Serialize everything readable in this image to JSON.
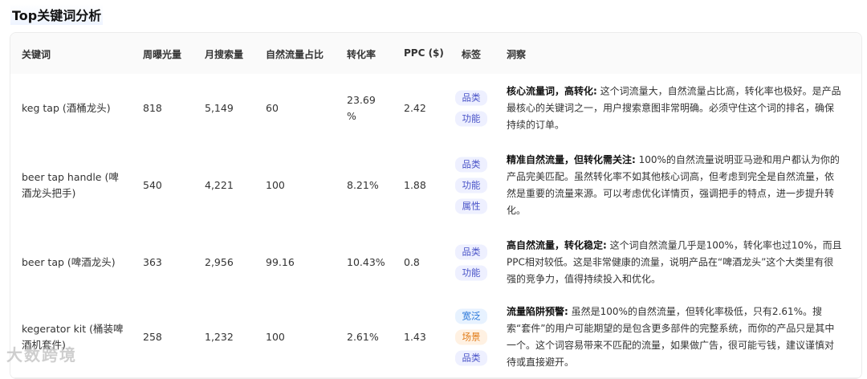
{
  "page": {
    "title": "Top关键词分析"
  },
  "table": {
    "headers": [
      "关键词",
      "周曝光量",
      "月搜索量",
      "自然流量占比",
      "转化率",
      "PPC ($)",
      "标签",
      "洞察"
    ],
    "rows": [
      {
        "keyword": "keg tap (酒桶龙头)",
        "weekly_impressions": "818",
        "monthly_searches": "5,149",
        "organic_share": "60",
        "conversion_rate": "23.69 %",
        "ppc": "2.42",
        "tags": [
          {
            "label": "品类",
            "color": "#4b55c8"
          },
          {
            "label": "功能",
            "color": "#4b55c8"
          }
        ],
        "insight_title": "核心流量词，高转化:",
        "insight_text": " 这个词流量大，自然流量占比高，转化率也极好。是产品最核心的关键词之一，用户搜索意图非常明确。必须守住这个词的排名，确保持续的订单。"
      },
      {
        "keyword": "beer tap handle (啤酒龙头把手)",
        "weekly_impressions": "540",
        "monthly_searches": "4,221",
        "organic_share": "100",
        "conversion_rate": "8.21%",
        "ppc": "1.88",
        "tags": [
          {
            "label": "品类",
            "color": "#4b55c8"
          },
          {
            "label": "功能",
            "color": "#4b55c8"
          },
          {
            "label": "属性",
            "color": "#4b55c8"
          }
        ],
        "insight_title": "精准自然流量，但转化需关注:",
        "insight_text": " 100%的自然流量说明亚马逊和用户都认为你的产品完美匹配。虽然转化率不如其他核心词高，但考虑到完全是自然流量，依然是重要的流量来源。可以考虑优化详情页，强调把手的特点，进一步提升转化。"
      },
      {
        "keyword": "beer tap (啤酒龙头)",
        "weekly_impressions": "363",
        "monthly_searches": "2,956",
        "organic_share": "99.16",
        "conversion_rate": "10.43%",
        "ppc": "0.8",
        "tags": [
          {
            "label": "品类",
            "color": "#4b55c8"
          },
          {
            "label": "功能",
            "color": "#4b55c8"
          }
        ],
        "insight_title": "高自然流量，转化稳定:",
        "insight_text": " 这个词自然流量几乎是100%，转化率也过10%，而且PPC相对较低。这是非常健康的流量，说明产品在“啤酒龙头”这个大类里有很强的竞争力，值得持续投入和优化。"
      },
      {
        "keyword": "kegerator kit (桶装啤酒机套件)",
        "weekly_impressions": "258",
        "monthly_searches": "1,232",
        "organic_share": "100",
        "conversion_rate": "2.61%",
        "ppc": "1.43",
        "tags": [
          {
            "label": "宽泛",
            "color": "#1e6fd6"
          },
          {
            "label": "场景",
            "color": "#e07a16"
          },
          {
            "label": "品类",
            "color": "#4b55c8"
          }
        ],
        "insight_title": "流量陷阱预警:",
        "insight_text": " 虽然是100%的自然流量，但转化率极低，只有2.61%。搜索“套件”的用户可能期望的是包含更多部件的完整系统，而你的产品只是其中一个。这个词容易带来不匹配的流量，如果做广告，很可能亏钱，建议谨慎对待或直接避开。"
      }
    ]
  },
  "watermark": {
    "text": "大数跨境"
  }
}
